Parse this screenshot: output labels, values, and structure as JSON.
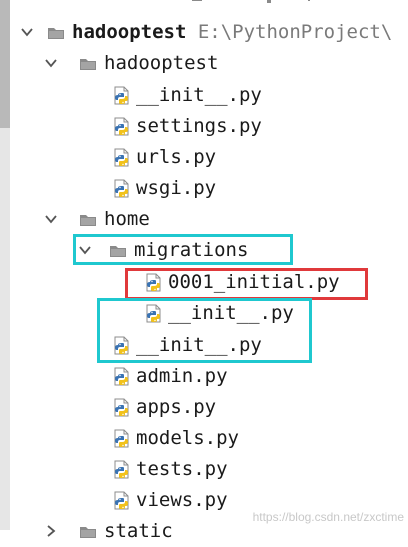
{
  "project_tree": {
    "root": {
      "name": "hadooptest",
      "path": "E:\\PythonProject\\"
    },
    "items": [
      {
        "label": "hadooptest"
      },
      {
        "label": "__init__.py"
      },
      {
        "label": "settings.py"
      },
      {
        "label": "urls.py"
      },
      {
        "label": "wsgi.py"
      },
      {
        "label": "home"
      },
      {
        "label": "migrations"
      },
      {
        "label": "0001_initial.py"
      },
      {
        "label": "__init__.py"
      },
      {
        "label": "__init__.py"
      },
      {
        "label": "admin.py"
      },
      {
        "label": "apps.py"
      },
      {
        "label": "models.py"
      },
      {
        "label": "tests.py"
      },
      {
        "label": "views.py"
      },
      {
        "label": "static"
      }
    ]
  },
  "annotations": {
    "cyan_color": "#1fc8cf",
    "red_color": "#e0393b"
  },
  "watermark": "https://blog.csdn.net/zxctime"
}
